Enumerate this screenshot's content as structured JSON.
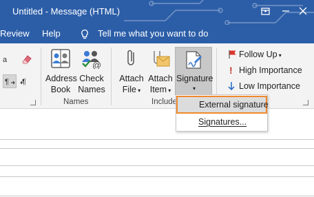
{
  "window": {
    "title": "Untitled  -  Message (HTML)",
    "restore_icon": "restore-window-icon",
    "minimize_icon": "minimize-icon",
    "close_icon": "close-icon"
  },
  "tabs": {
    "review": "Review",
    "help": "Help",
    "tell_me": "Tell me what you want to do"
  },
  "ribbon": {
    "address_book": [
      "Address",
      "Book"
    ],
    "check_names": [
      "Check",
      "Names"
    ],
    "attach_file": [
      "Attach",
      "File"
    ],
    "attach_item": [
      "Attach",
      "Item"
    ],
    "signature": "Signature",
    "group_names": "Names",
    "group_include": "Include",
    "follow_up": "Follow Up",
    "high_importance": "High Importance",
    "low_importance": "Low Importance"
  },
  "signature_menu": {
    "items": [
      "External signature",
      "Signatures..."
    ]
  },
  "colors": {
    "titlebar": "#2c5ea8",
    "ribbon": "#f3f3f3",
    "highlight_border": "#f0892b",
    "high_importance": "#c0392b",
    "low_importance": "#2e6fc4"
  }
}
